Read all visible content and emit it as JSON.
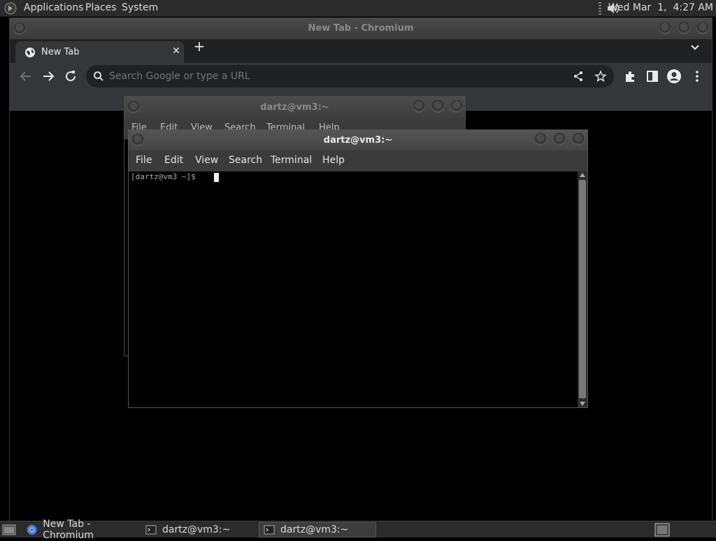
{
  "top_panel": {
    "menus": [
      "Applications",
      "Places",
      "System"
    ],
    "clock": "Wed Mar  1,  4:27 AM",
    "icons": [
      "gnome-foot-icon",
      "volume-icon"
    ]
  },
  "chromium": {
    "window_title": "New Tab - Chromium",
    "tab_title": "New Tab",
    "tab_close": "✕",
    "new_tab": "+",
    "omnibox_placeholder": "Search Google or type a URL",
    "toolbar_icons": [
      "back-icon",
      "forward-icon",
      "reload-icon",
      "search-icon",
      "share-icon",
      "bookmark-star-icon",
      "extensions-icon",
      "side-panel-icon",
      "profile-icon",
      "menu-icon"
    ]
  },
  "terminal_back": {
    "title": "dartz@vm3:~",
    "menus": [
      "File",
      "Edit",
      "View",
      "Search",
      "Terminal",
      "Help"
    ]
  },
  "terminal_front": {
    "title": "dartz@vm3:~",
    "menus": [
      "File",
      "Edit",
      "View",
      "Search",
      "Terminal",
      "Help"
    ],
    "prompt": "[dartz@vm3 ~]$ "
  },
  "bottom_panel": {
    "tasks": [
      "New Tab - Chromium",
      "dartz@vm3:~",
      "dartz@vm3:~"
    ],
    "active_task_index": 2
  },
  "colors": {
    "panel_bg": "#2b2b2b",
    "chrome_frame": "#202124",
    "chrome_toolbar": "#35363a",
    "terminal_bg": "#000000"
  }
}
